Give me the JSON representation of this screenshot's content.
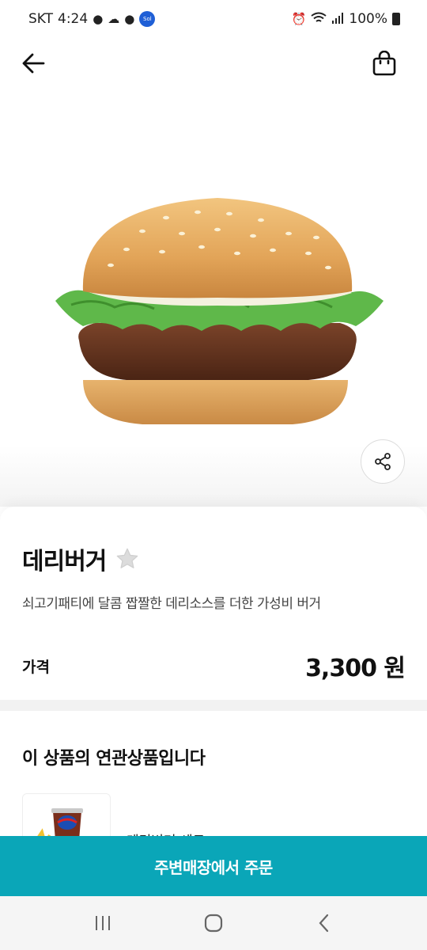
{
  "status": {
    "carrier": "SKT",
    "time": "4:24",
    "sol_badge": "Sol",
    "battery": "100%"
  },
  "icons": {
    "back": "arrow-left-icon",
    "cart": "shopping-bag-icon",
    "share": "share-icon",
    "favorite": "star-icon"
  },
  "product": {
    "name": "데리버거",
    "description": "쇠고기패티에 달콤 짭짤한 데리소스를 더한 가성비 버거",
    "price_label": "가격",
    "price": "3,300 원"
  },
  "related": {
    "title": "이 상품의 연관상품입니다",
    "items": [
      {
        "name": "데리버거 세트"
      }
    ]
  },
  "order": {
    "label": "주변매장에서 주문"
  },
  "colors": {
    "accent": "#0aa6b8"
  }
}
